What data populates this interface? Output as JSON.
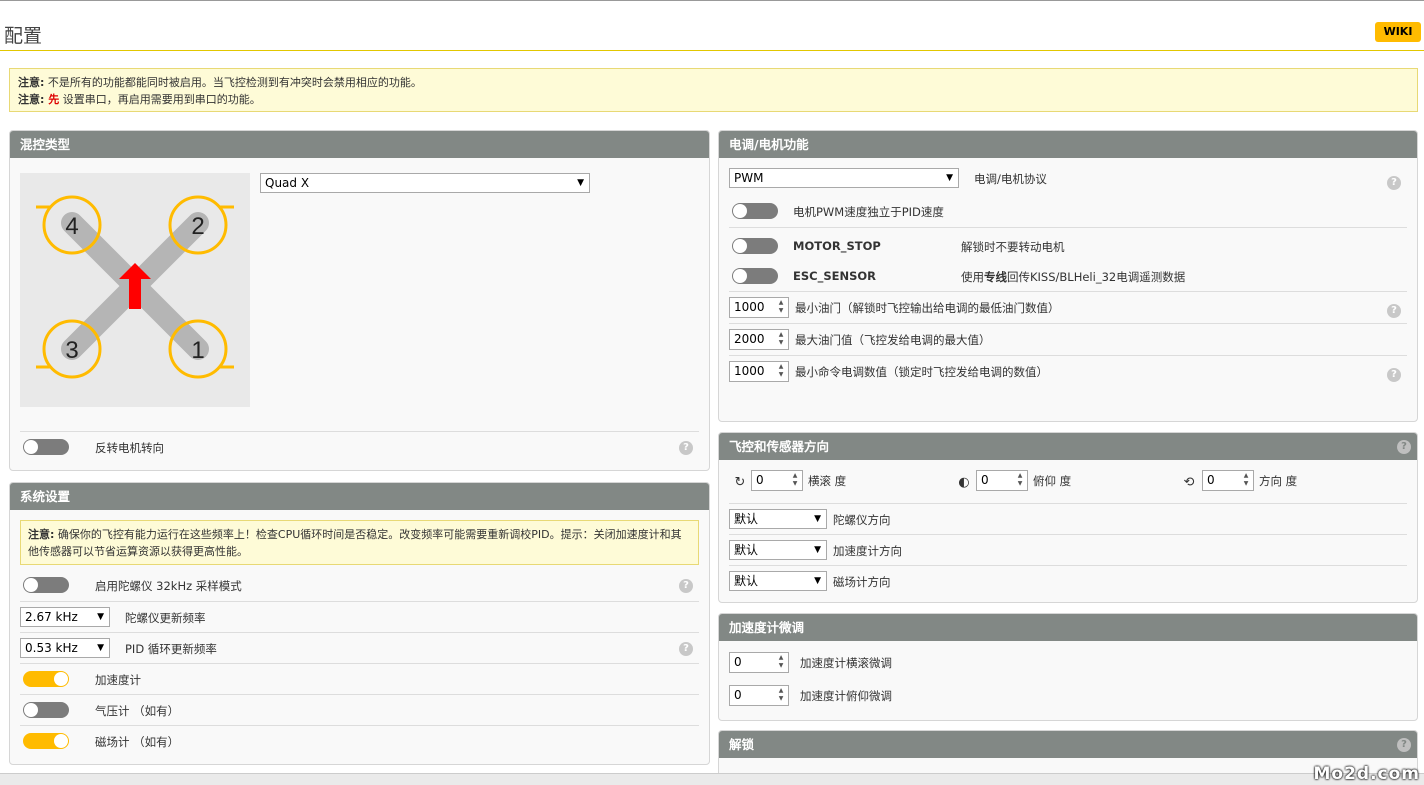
{
  "header": {
    "title": "配置",
    "wiki": "WIKI"
  },
  "note": {
    "line1_label": "注意:",
    "line1_text": " 不是所有的功能都能同时被启用。当飞控检测到有冲突时会禁用相应的功能。",
    "line2_label": "注意:",
    "line2_red": " 先",
    "line2_text": " 设置串口，再启用需要用到串口的功能。"
  },
  "mixer": {
    "title": "混控类型",
    "selected": "Quad X",
    "motors": [
      "4",
      "2",
      "3",
      "1"
    ],
    "reverse_label": "反转电机转向",
    "reverse_on": false
  },
  "system": {
    "title": "系统设置",
    "warn_label": "注意:",
    "warn_text": " 确保你的飞控有能力运行在这些频率上！检查CPU循环时间是否稳定。改变频率可能需要重新调校PID。提示：关闭加速度计和其他传感器可以节省运算资源以获得更高性能。",
    "gyro32_label": "启用陀螺仪 32kHz 采样模式",
    "gyro_rate_value": "2.67 kHz",
    "gyro_rate_label": "陀螺仪更新频率",
    "pid_rate_value": "0.53 kHz",
    "pid_rate_label": "PID 循环更新频率",
    "accel_label": "加速度计",
    "baro_label": "气压计 （如有）",
    "mag_label": "磁场计 （如有）"
  },
  "esc": {
    "title": "电调/电机功能",
    "protocol_value": "PWM",
    "protocol_label": "电调/电机协议",
    "unsynced_label": "电机PWM速度独立于PID速度",
    "motor_stop_name": "MOTOR_STOP",
    "motor_stop_desc": "解锁时不要转动电机",
    "esc_sensor_name": "ESC_SENSOR",
    "esc_sensor_desc_1": "使用",
    "esc_sensor_desc_bold": "专线",
    "esc_sensor_desc_2": "回传KISS/BLHeli_32电调遥测数据",
    "min_throttle_value": "1000",
    "min_throttle_label": "最小油门（解锁时飞控输出给电调的最低油门数值）",
    "max_throttle_value": "2000",
    "max_throttle_label": "最大油门值（飞控发给电调的最大值）",
    "min_command_value": "1000",
    "min_command_label": "最小命令电调数值（锁定时飞控发给电调的数值）"
  },
  "board": {
    "title": "飞控和传感器方向",
    "roll_value": "0",
    "roll_label": "横滚 度",
    "pitch_value": "0",
    "pitch_label": "俯仰 度",
    "yaw_value": "0",
    "yaw_label": "方向 度",
    "gyro_align_value": "默认",
    "gyro_align_label": "陀螺仪方向",
    "acc_align_value": "默认",
    "acc_align_label": "加速度计方向",
    "mag_align_value": "默认",
    "mag_align_label": "磁场计方向"
  },
  "acc_trim": {
    "title": "加速度计微调",
    "roll_value": "0",
    "roll_label": "加速度计横滚微调",
    "pitch_value": "0",
    "pitch_label": "加速度计俯仰微调"
  },
  "arming": {
    "title": "解锁"
  },
  "watermark": "Mo2d.com",
  "colors": {
    "accent": "#ffbb00",
    "panel_header": "#828885",
    "prop": "#ffbb00",
    "arrow": "#ff0000"
  }
}
